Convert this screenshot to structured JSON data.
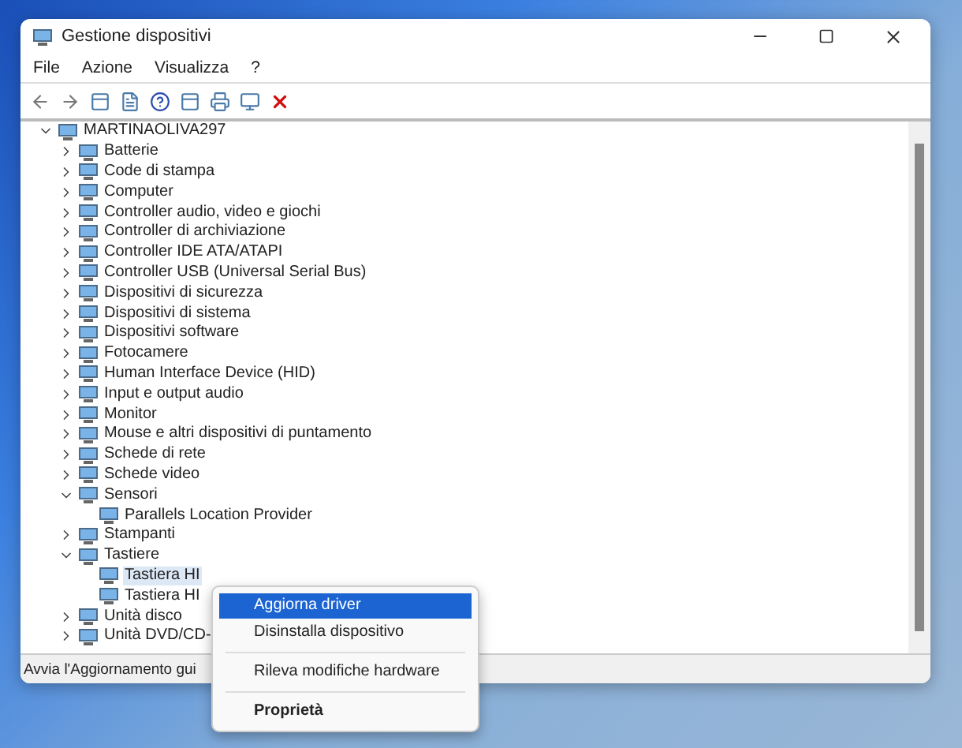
{
  "window": {
    "title": "Gestione dispositivi"
  },
  "menu": [
    "File",
    "Azione",
    "Visualizza",
    "?"
  ],
  "tree": {
    "label": "MARTINAOLIVA297",
    "expanded": true,
    "children": [
      {
        "label": "Batterie",
        "expanded": false
      },
      {
        "label": "Code di stampa",
        "expanded": false
      },
      {
        "label": "Computer",
        "expanded": false
      },
      {
        "label": "Controller audio, video e giochi",
        "expanded": false
      },
      {
        "label": "Controller di archiviazione",
        "expanded": false
      },
      {
        "label": "Controller IDE ATA/ATAPI",
        "expanded": false
      },
      {
        "label": "Controller USB (Universal Serial Bus)",
        "expanded": false
      },
      {
        "label": "Dispositivi di sicurezza",
        "expanded": false
      },
      {
        "label": "Dispositivi di sistema",
        "expanded": false
      },
      {
        "label": "Dispositivi software",
        "expanded": false
      },
      {
        "label": "Fotocamere",
        "expanded": false
      },
      {
        "label": "Human Interface Device (HID)",
        "expanded": false
      },
      {
        "label": "Input e output audio",
        "expanded": false
      },
      {
        "label": "Monitor",
        "expanded": false
      },
      {
        "label": "Mouse e altri dispositivi di puntamento",
        "expanded": false
      },
      {
        "label": "Schede di rete",
        "expanded": false
      },
      {
        "label": "Schede video",
        "expanded": false
      },
      {
        "label": "Sensori",
        "expanded": true,
        "children": [
          {
            "label": "Parallels Location Provider",
            "selected": false
          }
        ]
      },
      {
        "label": "Stampanti",
        "expanded": false
      },
      {
        "label": "Tastiere",
        "expanded": true,
        "children": [
          {
            "label": "Tastiera HI",
            "selected": true
          },
          {
            "label": "Tastiera HI",
            "selected": false
          }
        ]
      },
      {
        "label": "Unità disco",
        "expanded": false
      },
      {
        "label": "Unità DVD/CD-",
        "expanded": false
      }
    ]
  },
  "status_bar": "Avvia l'Aggiornamento gui",
  "context_menu": [
    {
      "kind": "item",
      "label": "Aggiorna driver",
      "selected": true
    },
    {
      "kind": "item",
      "label": "Disinstalla dispositivo",
      "selected": false
    },
    {
      "kind": "separator"
    },
    {
      "kind": "item",
      "label": "Rileva modifiche hardware",
      "selected": false
    },
    {
      "kind": "separator"
    },
    {
      "kind": "bold",
      "label": "Proprietà",
      "selected": false
    }
  ]
}
